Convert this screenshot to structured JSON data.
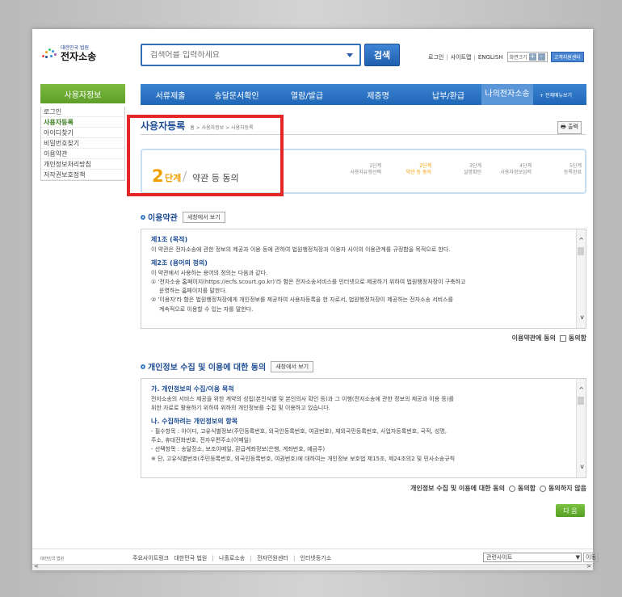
{
  "logo": {
    "small": "대한민국 법원",
    "big": "전자소송"
  },
  "search": {
    "placeholder": "검색어를 입력하세요",
    "button": "검색"
  },
  "util": {
    "login": "로그인",
    "sitemap": "사이트맵",
    "english": "ENGLISH",
    "zoom": "화면크기",
    "zoom_in": "+",
    "zoom_out": "-",
    "support": "고객지원센터"
  },
  "sidebar": {
    "title": "사용자정보",
    "items": [
      "로그인",
      "사용자등록",
      "아이디찾기",
      "비밀번호찾기",
      "이용약관",
      "개인정보처리방침",
      "저작권보호정책"
    ]
  },
  "nav": {
    "items": [
      "서류제출",
      "송달문서확인",
      "열람/발급",
      "제증명",
      "납부/환급",
      "나의전자소송"
    ],
    "all": "+ 전체메뉴보기"
  },
  "page": {
    "title": "사용자등록",
    "breadcrumb": "홈 > 사용자정보 > 사용자등록",
    "print": "출력"
  },
  "stepper": {
    "current_num": "2",
    "current_unit": "단계",
    "current_name": "약관 등 동의",
    "steps": [
      {
        "num": "1단계",
        "label": "사용자유형선택"
      },
      {
        "num": "2단계",
        "label": "약관 등 동의"
      },
      {
        "num": "3단계",
        "label": "실명확인"
      },
      {
        "num": "4단계",
        "label": "사용자정보입력"
      },
      {
        "num": "5단계",
        "label": "등록완료"
      }
    ]
  },
  "terms": {
    "title": "이용약관",
    "newwin": "새창에서 보기",
    "art1_title": "제1조 (목적)",
    "art1_body": "이 약관은 전자소송에 관한 정보의 제공과 이용 등에 관하여 법원행정처장과 이용자 사이의 이용관계를 규정함을 목적으로 한다.",
    "art2_title": "제2조 (용어의 정의)",
    "art2_intro": "이 약관에서 사용하는 용어의 정의는 다음과 같다.",
    "art2_item1": "① '전자소송 홈페이지(https://ecfs.scourt.go.kr)'라 함은 전자소송서비스를 인터넷으로 제공하기 위하여 법원행정처장이 구축하고",
    "art2_item1b": "운영하는 홈페이지를 말한다.",
    "art2_item2": "② '이용자'라 함은 법원행정처장에게 개인정보를 제공하여 사용자등록을 한 자로서, 법원행정처장이 제공하는 전자소송 서비스를",
    "art2_item2b": "계속적으로 이용할 수 있는 자를 말한다.",
    "agree": "이용약관에 동의",
    "agree_opt": "동의함"
  },
  "privacy": {
    "title": "개인정보 수집 및 이용에 대한 동의",
    "newwin": "새창에서 보기",
    "a_title": "가. 개인정보의 수집/이용 목적",
    "a_body1": "전자소송의 서비스 제공을 위한 계약의 성립(본인식별 및 본인의사 확인 등)과 그 이행(전자소송에 관한 정보의 제공과 이용 등)를",
    "a_body2": "위한 자료로 활용하기 위하여 위하의 개인정보를 수집 및 이용하고 있습니다.",
    "b_title": "나. 수집하려는 개인정보의 항목",
    "b_line1": "- 필수항목 : 아이디, 고유식별정보(주민등록번호, 외국인등록번호, 여권번호), 재외국민등록번호, 사업자등록번호, 국적, 성명,",
    "b_line2": "주소, 휴대전화번호, 전자우편주소(이메일)",
    "b_line3": "- 선택항목 : 송달장소, 보조이메일, 환급계좌정보(은행, 계좌번호, 예금주)",
    "b_line4": "※ 단, 고유식별번호(주민등록번호, 외국인등록번호, 여권번호)에 대하여는 개인정보 보호법 제15조, 제24조의2 및 민사소송규칙",
    "agree": "개인정보 수집 및 이용에 대한 동의",
    "agree_yes": "동의함",
    "agree_no": "동의하지 않음"
  },
  "next": "다 음",
  "footer": {
    "logo": "대한민국 법원",
    "links_label": "주요사이트링크",
    "links": [
      "대한민국 법원",
      "나홀로소송",
      "전자민원센터",
      "인터넷등기소"
    ],
    "related": "관련사이트",
    "go": "이동"
  }
}
